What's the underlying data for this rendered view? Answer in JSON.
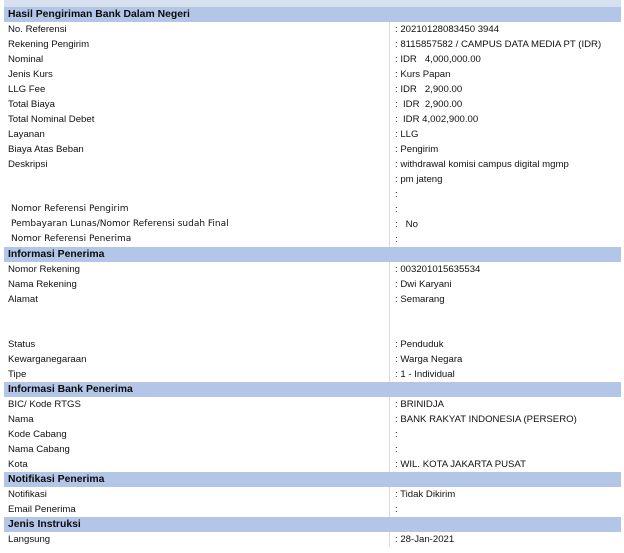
{
  "sections": {
    "hasil": "Hasil Pengiriman Bank Dalam Negeri",
    "penerima": "Informasi Penerima",
    "bank": "Informasi Bank Penerima",
    "notifikasi": "Notifikasi Penerima",
    "instruksi": "Jenis Instruksi"
  },
  "hasil": {
    "no_referensi_label": "No. Referensi",
    "no_referensi_value": ": 20210128083450 3944",
    "rekening_pengirim_label": "Rekening Pengirim",
    "rekening_pengirim_value": ": 8115857582 / CAMPUS DATA MEDIA PT (IDR)",
    "nominal_label": "Nominal",
    "nominal_value": ": IDR   4,000,000.00",
    "jenis_kurs_label": "Jenis Kurs",
    "jenis_kurs_value": ": Kurs Papan",
    "llg_fee_label": "LLG Fee",
    "llg_fee_value": ": IDR   2,900.00",
    "total_biaya_label": "Total Biaya",
    "total_biaya_value": ":  IDR  2,900.00",
    "total_nominal_label": "Total Nominal Debet",
    "total_nominal_value": ":  IDR 4,002,900.00",
    "layanan_label": "Layanan",
    "layanan_value": ": LLG",
    "biaya_beban_label": "Biaya Atas Beban",
    "biaya_beban_value": ": Pengirim",
    "deskripsi_label": "Deskripsi",
    "deskripsi_line1": ": withdrawal komisi campus digital mgmp",
    "deskripsi_line2": ": pm jateng",
    "deskripsi_line3": ":",
    "nomor_ref_pengirim_label": "Nomor Referensi Pengirim",
    "nomor_ref_pengirim_value": ":",
    "pembayaran_lunas_label": "Pembayaran Lunas/Nomor Referensi sudah Final",
    "pembayaran_lunas_value": ":   No",
    "nomor_ref_penerima_label": "Nomor Referensi Penerima",
    "nomor_ref_penerima_value": ":"
  },
  "penerima": {
    "nomor_rekening_label": "Nomor Rekening",
    "nomor_rekening_value": ": 003201015635534",
    "nama_rekening_label": "Nama Rekening",
    "nama_rekening_value": ": Dwi Karyani",
    "alamat_label": "Alamat",
    "alamat_value": ": Semarang",
    "status_label": "Status",
    "status_value": ": Penduduk",
    "kewarganegaraan_label": "Kewarganegaraan",
    "kewarganegaraan_value": ": Warga Negara",
    "tipe_label": "Tipe",
    "tipe_value": ": 1 - Individual"
  },
  "bank": {
    "bic_label": "BIC/ Kode RTGS",
    "bic_value": ": BRINIDJA",
    "nama_label": "Nama",
    "nama_value": ": BANK RAKYAT INDONESIA (PERSERO)",
    "kode_cabang_label": "Kode Cabang",
    "kode_cabang_value": ":",
    "nama_cabang_label": "Nama Cabang",
    "nama_cabang_value": ":",
    "kota_label": "Kota",
    "kota_value": ": WIL. KOTA JAKARTA PUSAT"
  },
  "notifikasi": {
    "notifikasi_label": "Notifikasi",
    "notifikasi_value": ": Tidak Dikirim",
    "email_label": "Email Penerima",
    "email_value": ":"
  },
  "instruksi": {
    "langsung_label": "Langsung",
    "langsung_value": ": 28-Jan-2021"
  }
}
